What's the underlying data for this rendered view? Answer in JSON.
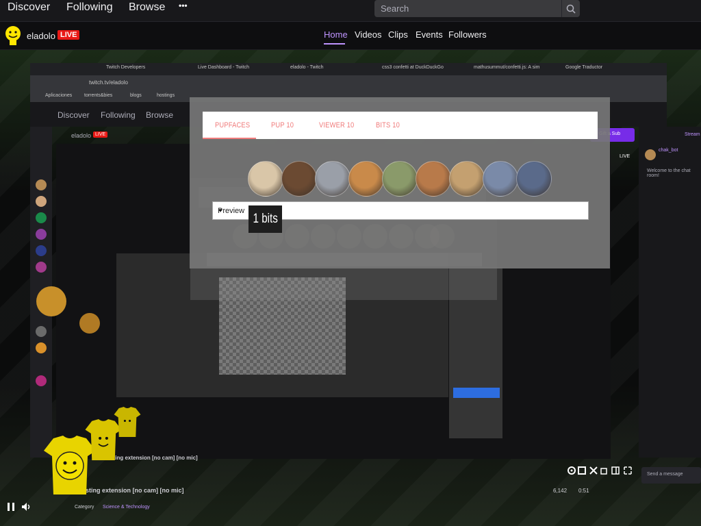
{
  "topnav": {
    "discover": "Discover",
    "following": "Following",
    "browse": "Browse",
    "more": "•••"
  },
  "search": {
    "placeholder": "Search"
  },
  "channel": {
    "name": "eladolo",
    "live": "LIVE"
  },
  "tabs": [
    "Home",
    "Videos",
    "Clips",
    "Events",
    "Followers"
  ],
  "colors": {
    "accent": "#bf94ff",
    "live": "#e91916",
    "ext_tab": "#f07b7b"
  },
  "inner": {
    "browser_tabs": [
      "Twitch Developers",
      "Live Dashboard - Twitch",
      "eladolo - Twitch",
      "css3 confetti at DuckDuckGo",
      "mathusummut/confetti.js: A sim",
      "Google Traductor"
    ],
    "url": "twitch.tv/eladolo",
    "bookmarks": [
      "Aplicaciones",
      "torrents&bies",
      "blogs",
      "hostings"
    ],
    "nav": {
      "discover": "Discover",
      "following": "Following",
      "browse": "Browse"
    },
    "channel": "eladolo",
    "live": "LIVE",
    "live_tag": "LIVE",
    "gifts": "Gift a Sub",
    "stream": "Stream",
    "chat_user": "chak_bot",
    "chat_message": "Welcome to the chat room!",
    "send": "Send a message",
    "stream_title": "testing extension [no cam] [no mic]",
    "category": "Category",
    "category_value": "Science & Technology",
    "viewers": "6,142",
    "time": "0:51"
  },
  "extension": {
    "tabs": [
      "PUPFACES",
      "PUP 10",
      "VIEWER 10",
      "BITS 10"
    ],
    "select_value": "Preview",
    "select_arrow": "▼",
    "tooltip": "1 bits",
    "pup_count": 9
  }
}
